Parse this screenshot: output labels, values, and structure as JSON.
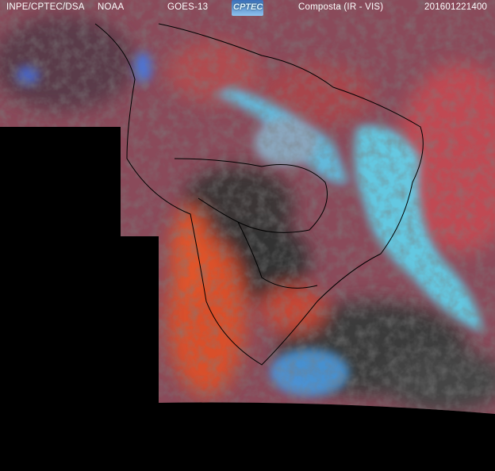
{
  "header": {
    "institution": "INPE/CPTEC/DSA",
    "agency": "NOAA",
    "satellite": "GOES-13",
    "logo_text": "CPTEC",
    "product": "Composta (IR - VIS)",
    "timestamp": "201601221400"
  },
  "colors": {
    "background": "#000000",
    "land_red": "#b0484a",
    "cloud_cyan": "#5fd6f0",
    "desert_orange": "#e0502a",
    "clear_gray": "#3a3a3a"
  }
}
